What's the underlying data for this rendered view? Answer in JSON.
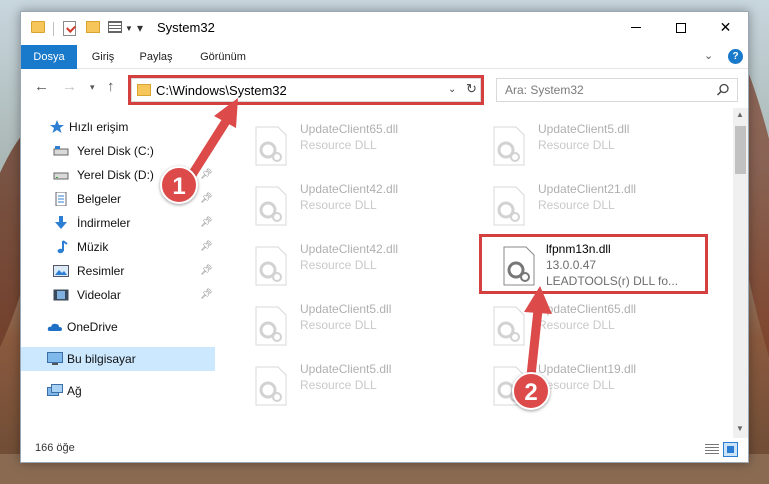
{
  "window": {
    "title": "System32",
    "controls": {
      "minimize": "minimize-icon",
      "maximize": "maximize-icon",
      "close": "close-icon"
    }
  },
  "quick_access_toolbar": {
    "icons": [
      "folder-icon",
      "properties-icon",
      "new-folder-icon",
      "view-icon"
    ]
  },
  "ribbon": {
    "tabs": [
      {
        "label": "Dosya",
        "active": true
      },
      {
        "label": "Giriş"
      },
      {
        "label": "Paylaş"
      },
      {
        "label": "Görünüm"
      }
    ],
    "help_label": "?"
  },
  "navigation": {
    "address_path": "C:\\Windows\\System32",
    "search_placeholder": "Ara: System32"
  },
  "sidebar": {
    "items": [
      {
        "label": "Hızlı erişim",
        "icon": "star-icon"
      },
      {
        "label": "Yerel Disk (C:)",
        "icon": "drive-icon",
        "pinned": true
      },
      {
        "label": "Yerel Disk (D:)",
        "icon": "drive-icon",
        "pinned": true
      },
      {
        "label": "Belgeler",
        "icon": "documents-icon",
        "pinned": true
      },
      {
        "label": "İndirmeler",
        "icon": "download-icon",
        "pinned": true
      },
      {
        "label": "Müzik",
        "icon": "music-icon",
        "pinned": true
      },
      {
        "label": "Resimler",
        "icon": "pictures-icon",
        "pinned": true
      },
      {
        "label": "Videolar",
        "icon": "videos-icon",
        "pinned": true
      },
      {
        "label": "OneDrive",
        "icon": "cloud-icon"
      },
      {
        "label": "Bu bilgisayar",
        "icon": "computer-icon",
        "selected": true
      },
      {
        "label": "Ağ",
        "icon": "network-icon"
      }
    ]
  },
  "files": {
    "items": [
      {
        "name": "UpdateClient65.dll",
        "type": "Resource DLL"
      },
      {
        "name": "UpdateClient5.dll",
        "type": "Resource DLL"
      },
      {
        "name": "UpdateClient42.dll",
        "type": "Resource DLL"
      },
      {
        "name": "UpdateClient21.dll",
        "type": "Resource DLL"
      },
      {
        "name": "UpdateClient42.dll",
        "type": "Resource DLL"
      },
      {
        "name": "lfpnm13n.dll",
        "version": "13.0.0.47",
        "type": "LEADTOOLS(r) DLL fo..."
      },
      {
        "name": "UpdateClient5.dll",
        "type": "Resource DLL"
      },
      {
        "name": "UpdateClient65.dll",
        "type": "Resource DLL"
      },
      {
        "name": "UpdateClient5.dll",
        "type": "Resource DLL"
      },
      {
        "name": "UpdateClient19.dll",
        "type": "Resource DLL"
      }
    ]
  },
  "status": {
    "item_count": "166 öğe"
  },
  "annotations": {
    "marker1": "1",
    "marker2": "2",
    "color": "#dc4a4a"
  },
  "colors": {
    "accent": "#1979ca",
    "selection": "#cce8ff",
    "highlight": "#d43f3f"
  }
}
